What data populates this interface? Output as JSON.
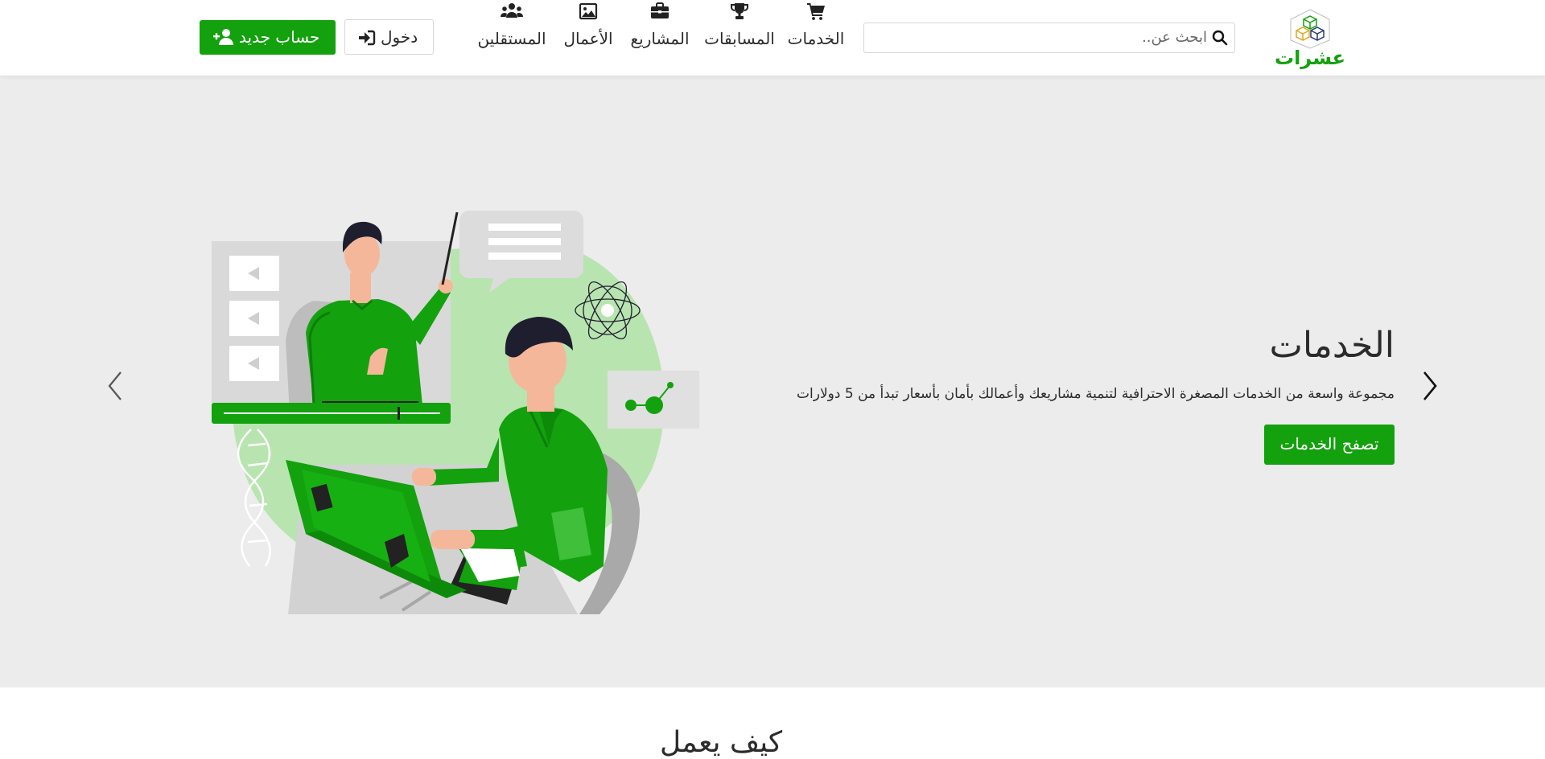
{
  "header": {
    "logo_text": "عشرات",
    "search": {
      "placeholder": "ابحث عن.."
    },
    "nav": [
      {
        "label": "الخدمات",
        "icon": "cart-icon"
      },
      {
        "label": "المسابقات",
        "icon": "trophy-icon"
      },
      {
        "label": "المشاريع",
        "icon": "briefcase-icon"
      },
      {
        "label": "الأعمال",
        "icon": "image-icon"
      },
      {
        "label": "المستقلين",
        "icon": "users-icon"
      }
    ],
    "login_label": "دخول",
    "register_label": "حساب جديد"
  },
  "hero": {
    "title": "الخدمات",
    "description": "مجموعة واسعة من الخدمات المصغرة الاحترافية لتنمية مشاريعك وأعمالك بأمان بأسعار تبدأ من 5 دولارات",
    "button_label": "تصفح الخدمات"
  },
  "colors": {
    "brand": "#13a10e",
    "hero_bg": "#ececec",
    "light_green": "#b8e4b0"
  },
  "below": {
    "heading": "كيف يعمل"
  }
}
